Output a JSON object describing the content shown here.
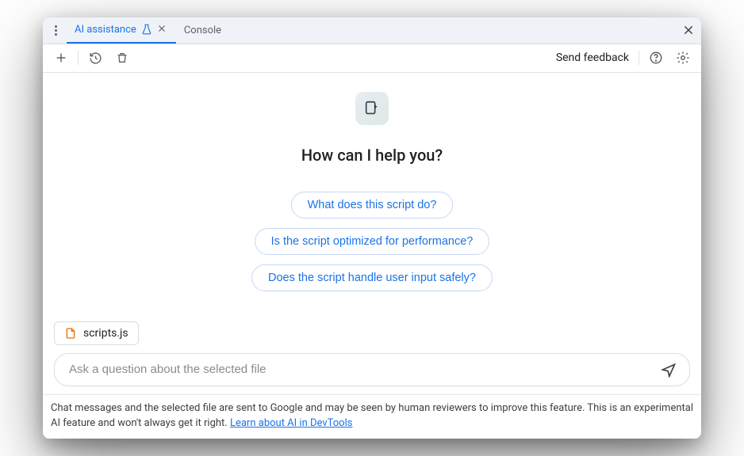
{
  "tabs": {
    "ai_assistance": "AI assistance",
    "console": "Console"
  },
  "toolbar": {
    "send_feedback": "Send feedback"
  },
  "main": {
    "heading": "How can I help you?",
    "suggestions": [
      "What does this script do?",
      "Is the script optimized for performance?",
      "Does the script handle user input safely?"
    ],
    "selected_file": "scripts.js",
    "input_placeholder": "Ask a question about the selected file"
  },
  "footer": {
    "text": "Chat messages and the selected file are sent to Google and may be seen by human reviewers to improve this feature. This is an experimental AI feature and won't always get it right. ",
    "link_text": "Learn about AI in DevTools"
  }
}
